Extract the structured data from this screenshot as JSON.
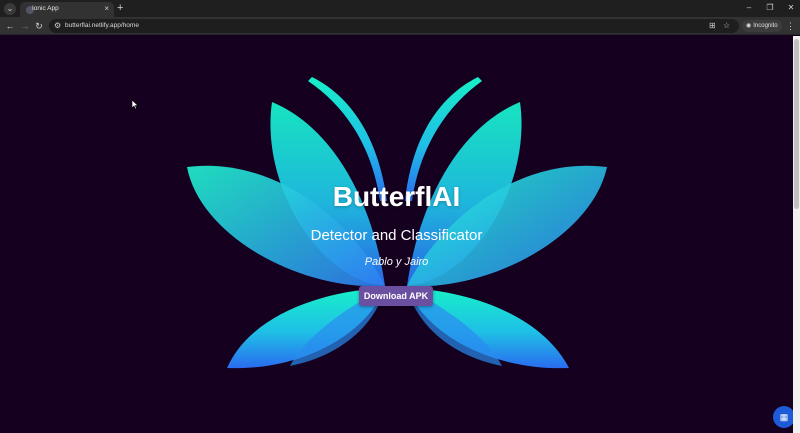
{
  "browser": {
    "tab_search_icon": "chevron-down-icon",
    "tab_title": "Ionic App",
    "tab_close": "×",
    "new_tab": "+",
    "window": {
      "minimize": "–",
      "restore": "❐",
      "close": "✕"
    },
    "nav": {
      "back": "←",
      "forward": "→",
      "reload": "↻"
    },
    "url": "butterflai.netlify.app/home",
    "incognito_label": "Incognito",
    "menu": "⋮"
  },
  "hero": {
    "title": "ButterflAI",
    "subtitle": "Detector and Classificator",
    "authors": "Pablo y Jairo",
    "download_label": "Download APK"
  },
  "colors": {
    "background": "#15001f",
    "wing_top": "#17f0c8",
    "wing_bottom": "#2a6cf0",
    "button": "#6b4fa0",
    "fab": "#1f5bd8"
  }
}
